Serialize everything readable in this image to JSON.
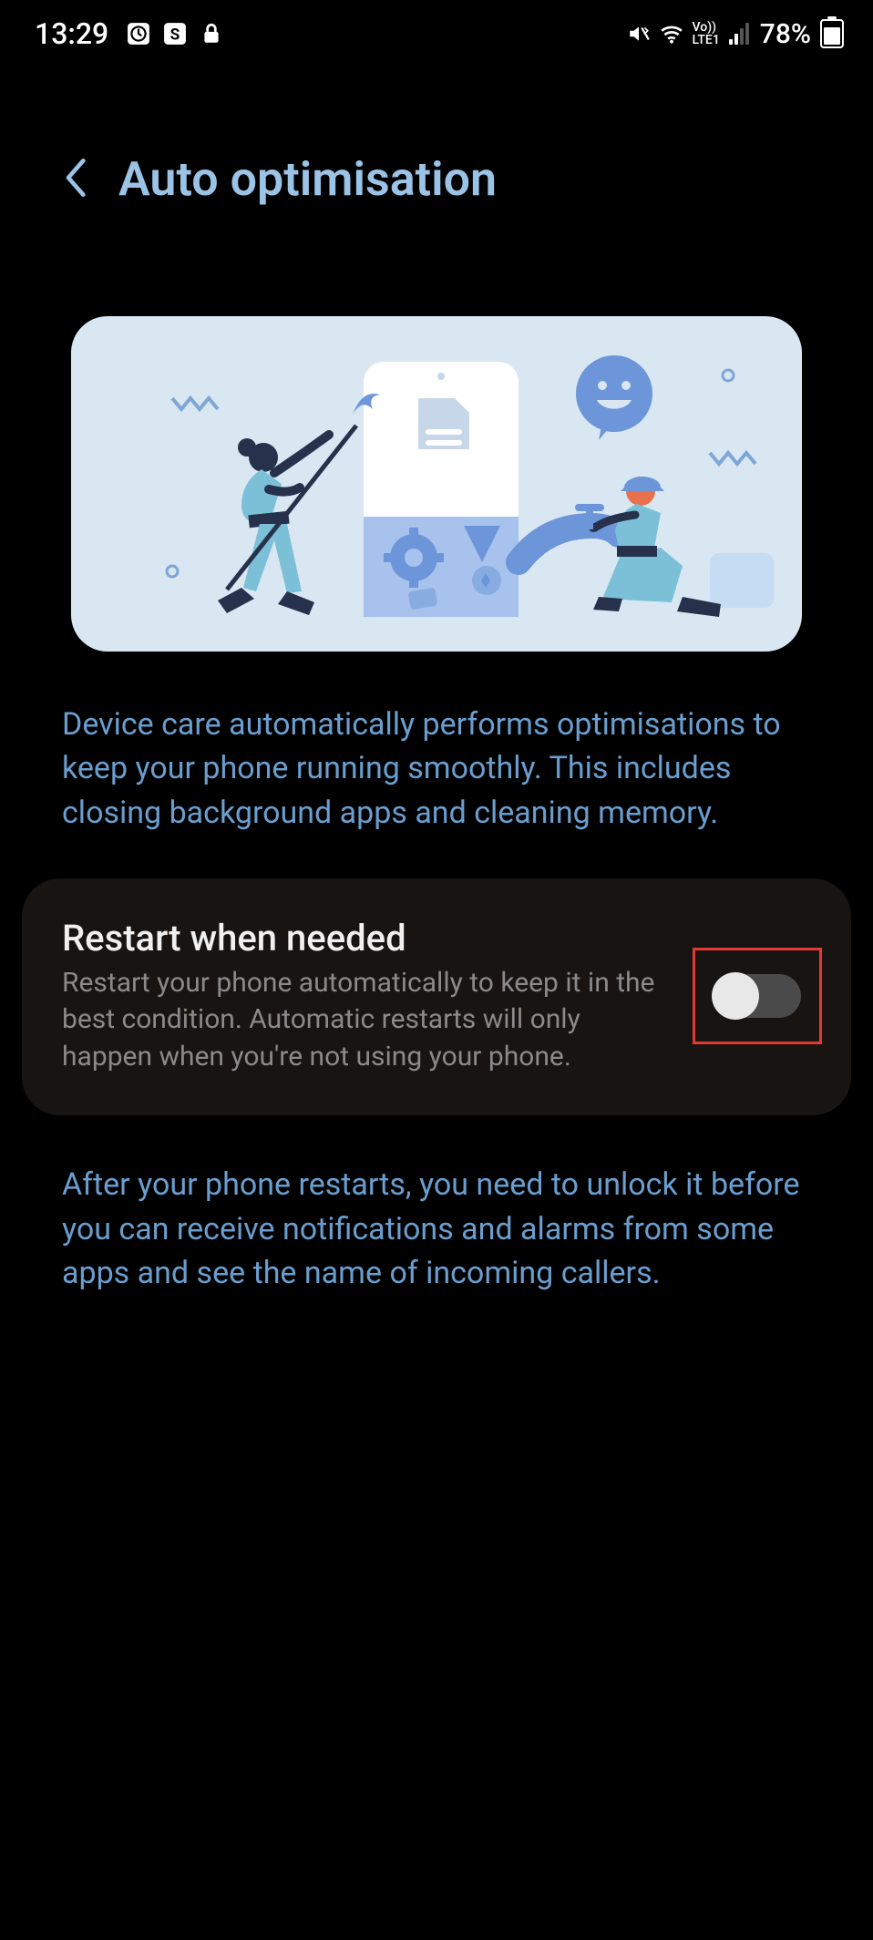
{
  "status_bar": {
    "time": "13:29",
    "battery_pct": "78%",
    "network_label": "Vo))\nLTE1"
  },
  "header": {
    "title": "Auto optimisation"
  },
  "description": "Device care automatically performs optimisations to keep your phone running smoothly. This includes closing background apps and cleaning memory.",
  "setting": {
    "title": "Restart when needed",
    "subtitle": "Restart your phone automatically to keep it in the best condition. Automatic restarts will only happen when you're not using your phone.",
    "enabled": false
  },
  "footer_note": "After your phone restarts, you need to unlock it before you can receive notifications and alarms from some apps and see the name of incoming callers."
}
